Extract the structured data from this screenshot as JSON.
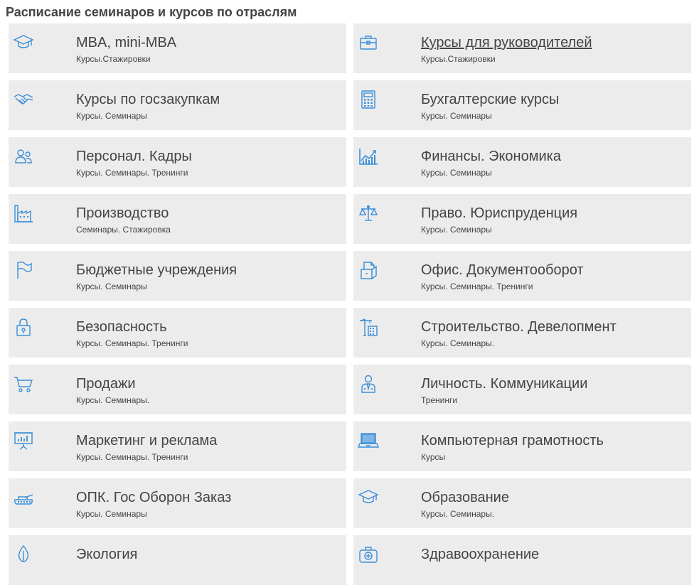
{
  "page_title": "Расписание семинаров и курсов по отраслям",
  "accent_color": "#3a8ed8",
  "items": [
    {
      "title": "MBA, mini-MBA",
      "subtitle": "Курсы.Стажировки",
      "icon": "graduation-cap-icon"
    },
    {
      "title": "Курсы для руководителей",
      "subtitle": "Курсы.Стажировки",
      "icon": "briefcase-icon"
    },
    {
      "title": "Курсы по госзакупкам",
      "subtitle": "Курсы. Семинары",
      "icon": "handshake-icon"
    },
    {
      "title": "Бухгалтерские курсы",
      "subtitle": "Курсы. Семинары",
      "icon": "calculator-icon"
    },
    {
      "title": "Персонал. Кадры",
      "subtitle": "Курсы. Семинары. Тренинги",
      "icon": "people-icon"
    },
    {
      "title": "Финансы. Экономика",
      "subtitle": "Курсы. Семинары",
      "icon": "chart-growth-icon"
    },
    {
      "title": "Производство",
      "subtitle": "Семинары. Стажировка",
      "icon": "factory-icon"
    },
    {
      "title": "Право. Юриспруденция",
      "subtitle": "Курсы. Семинары",
      "icon": "scales-icon"
    },
    {
      "title": " Бюджетные учреждения",
      "subtitle": "Курсы. Семинары",
      "icon": "flag-icon"
    },
    {
      "title": "Офис. Документооборот",
      "subtitle": "Курсы. Семинары. Тренинги",
      "icon": "documents-box-icon"
    },
    {
      "title": "Безопасность",
      "subtitle": "Курсы. Семинары. Тренинги",
      "icon": "lock-icon"
    },
    {
      "title": "Строительство. Девелопмент",
      "subtitle": "Курсы. Семинары.",
      "icon": "crane-building-icon"
    },
    {
      "title": "Продажи",
      "subtitle": "Курсы. Семинары.",
      "icon": "shopping-cart-icon"
    },
    {
      "title": "Личность. Коммуникации",
      "subtitle": "Тренинги",
      "icon": "person-suit-icon"
    },
    {
      "title": "Маркетинг и реклама",
      "subtitle": "Курсы. Семинары. Тренинги",
      "icon": "presentation-board-icon"
    },
    {
      "title": "Компьютерная грамотность",
      "subtitle": "Курсы",
      "icon": "laptop-icon"
    },
    {
      "title": "ОПК. Гос Оборон Заказ",
      "subtitle": "Курсы. Семинары",
      "icon": "tank-icon"
    },
    {
      "title": "Образование",
      "subtitle": "Курсы. Семинары.",
      "icon": "graduation-cap-icon"
    },
    {
      "title": " Экология",
      "subtitle": "",
      "icon": "leaf-drop-icon"
    },
    {
      "title": "Здравоохранение",
      "subtitle": "",
      "icon": "medical-kit-icon"
    }
  ]
}
